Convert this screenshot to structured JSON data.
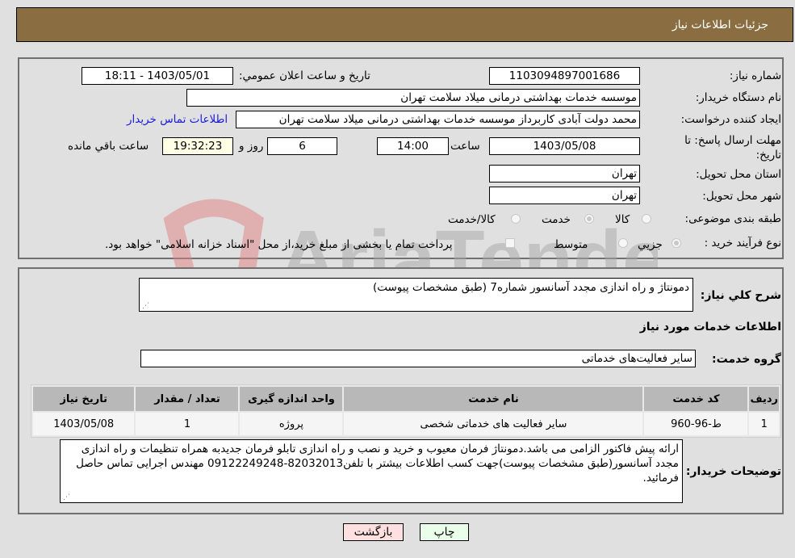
{
  "header": {
    "title": "جزئيات اطلاعات نياز"
  },
  "fields": {
    "need_number": {
      "label": "شماره نياز:",
      "value": "1103094897001686"
    },
    "announce_datetime": {
      "label": "تاريخ و ساعت اعلان عمومي:",
      "value": "1403/05/01 - 18:11"
    },
    "buyer_org": {
      "label": "نام دستگاه خريدار:",
      "value": "موسسه خدمات بهداشتی درمانی میلاد سلامت تهران"
    },
    "requester": {
      "label": "ايجاد کننده درخواست:",
      "value": "محمد دولت آبادی کاربرداز موسسه خدمات بهداشتی درمانی میلاد سلامت تهران",
      "contact_link": "اطلاعات تماس خريدار"
    },
    "deadline": {
      "label_line1": "مهلت ارسال پاسخ: تا",
      "label_line2": "تاريخ:",
      "date": "1403/05/08",
      "time_label": "ساعت",
      "time": "14:00",
      "days": "6",
      "days_label": "روز و",
      "remaining": "19:32:23",
      "remaining_label": "ساعت باقي مانده"
    },
    "province": {
      "label": "استان محل تحويل:",
      "value": "تهران"
    },
    "city": {
      "label": "شهر محل تحويل:",
      "value": "تهران"
    },
    "category": {
      "label": "طبقه بندی موضوعی:",
      "options": [
        {
          "label": "کالا",
          "selected": false
        },
        {
          "label": "خدمت",
          "selected": true
        },
        {
          "label": "کالا/خدمت",
          "selected": false
        }
      ]
    },
    "purchase_type": {
      "label": "نوع فرآيند خريد :",
      "options": [
        {
          "label": "جزيي",
          "selected": true
        },
        {
          "label": "متوسط",
          "selected": false
        }
      ],
      "treasury_checkbox_label": "پرداخت تمام يا بخشی از مبلغ خريد،از محل \"اسناد خزانه اسلامی\" خواهد بود."
    }
  },
  "description": {
    "label": "شرح کلي نياز:",
    "value": "دمونتاژ و راه اندازی مجدد آسانسور شماره7 (طبق مشخصات پیوست)"
  },
  "services_section": {
    "title": "اطلاعات خدمات مورد نياز"
  },
  "service_group": {
    "label": "گروه خدمت:",
    "value": "ساير فعاليت‌هاى خدماتى"
  },
  "table": {
    "headers": [
      "رديف",
      "کد خدمت",
      "نام خدمت",
      "واحد اندازه گيری",
      "تعداد / مقدار",
      "تاريخ نياز"
    ],
    "rows": [
      [
        "1",
        "ط-96-960",
        "ساير فعاليت های خدماتی شخصی",
        "پروژه",
        "1",
        "1403/05/08"
      ]
    ]
  },
  "buyer_notes": {
    "label": "توضيحات خريدار:",
    "value": "ارائه پیش فاکتور الزامی می باشد.دمونتاژ فرمان معیوب و خرید و نصب و راه اندازی تابلو فرمان جدیدبه همراه تنظیمات و راه اندازی مجدد آسانسور(طبق مشخصات پیوست)جهت کسب اطلاعات بیشتر با تلفن82032013-09122249248 مهندس اجرایی تماس حاصل فرمائید."
  },
  "buttons": {
    "print": "چاپ",
    "back": "بازگشت"
  },
  "watermark": {
    "text": "AriaTender.neT"
  },
  "colors": {
    "header_bg": "#8b6d42",
    "link": "#1a1adb",
    "remaining_bg": "#ffffe6",
    "back_btn": "#ffe0e0",
    "print_btn": "#eaffea"
  }
}
